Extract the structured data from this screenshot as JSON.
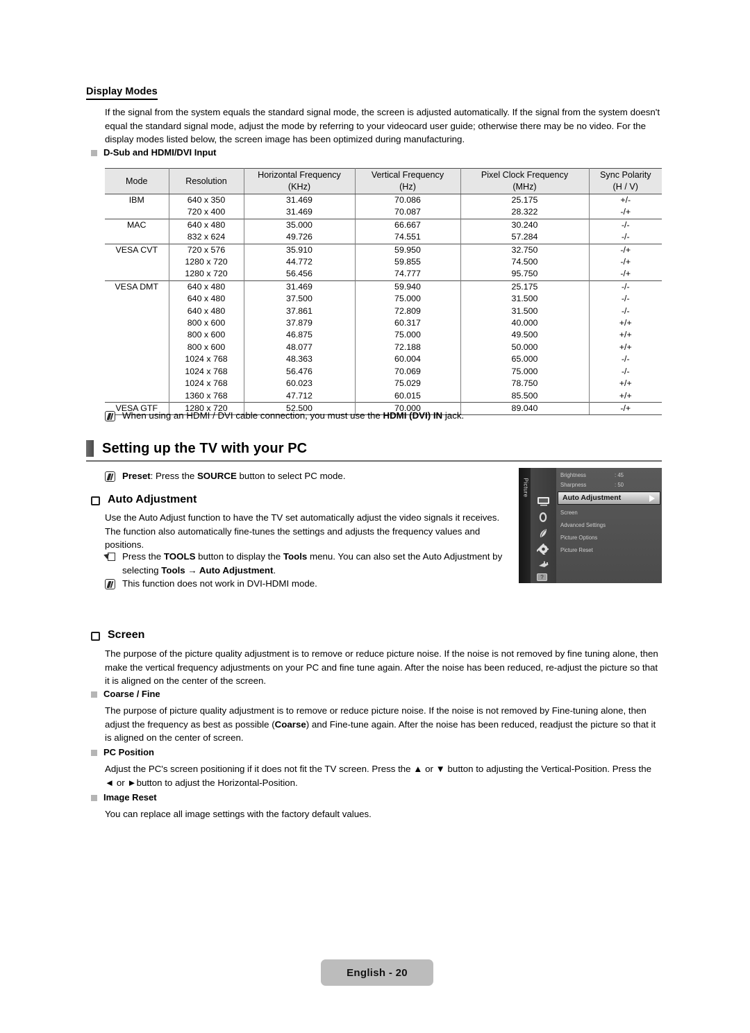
{
  "document": {
    "display_modes": {
      "section_title": "Display Modes",
      "intro": "If the signal from the system equals the standard signal mode, the screen is adjusted automatically. If the signal from the system doesn't equal the standard signal mode, adjust the mode by referring to your videocard user guide; otherwise there may be no video. For the display modes listed below, the screen image has been optimized during manufacturing.",
      "subheading": "D-Sub and HDMI/DVI Input"
    },
    "table": {
      "headers": [
        {
          "line1": "Mode",
          "line2": ""
        },
        {
          "line1": "Resolution",
          "line2": ""
        },
        {
          "line1": "Horizontal Frequency",
          "line2": "(KHz)"
        },
        {
          "line1": "Vertical Frequency",
          "line2": "(Hz)"
        },
        {
          "line1": "Pixel Clock Frequency",
          "line2": "(MHz)"
        },
        {
          "line1": "Sync Polarity",
          "line2": "(H / V)"
        }
      ],
      "rows": [
        {
          "mode": "IBM",
          "group_start": true,
          "resolution": "640 x 350",
          "hfreq": "31.469",
          "vfreq": "70.086",
          "pclock": "25.175",
          "sync": "+/-"
        },
        {
          "mode": "",
          "group_start": false,
          "resolution": "720 x 400",
          "hfreq": "31.469",
          "vfreq": "70.087",
          "pclock": "28.322",
          "sync": "-/+"
        },
        {
          "mode": "MAC",
          "group_start": true,
          "resolution": "640 x 480",
          "hfreq": "35.000",
          "vfreq": "66.667",
          "pclock": "30.240",
          "sync": "-/-"
        },
        {
          "mode": "",
          "group_start": false,
          "resolution": "832 x 624",
          "hfreq": "49.726",
          "vfreq": "74.551",
          "pclock": "57.284",
          "sync": "-/-"
        },
        {
          "mode": "VESA CVT",
          "group_start": true,
          "resolution": "720 x 576",
          "hfreq": "35.910",
          "vfreq": "59.950",
          "pclock": "32.750",
          "sync": "-/+"
        },
        {
          "mode": "",
          "group_start": false,
          "resolution": "1280 x 720",
          "hfreq": "44.772",
          "vfreq": "59.855",
          "pclock": "74.500",
          "sync": "-/+"
        },
        {
          "mode": "",
          "group_start": false,
          "resolution": "1280 x 720",
          "hfreq": "56.456",
          "vfreq": "74.777",
          "pclock": "95.750",
          "sync": "-/+"
        },
        {
          "mode": "VESA DMT",
          "group_start": true,
          "resolution": "640 x 480",
          "hfreq": "31.469",
          "vfreq": "59.940",
          "pclock": "25.175",
          "sync": "-/-"
        },
        {
          "mode": "",
          "group_start": false,
          "resolution": "640 x 480",
          "hfreq": "37.500",
          "vfreq": "75.000",
          "pclock": "31.500",
          "sync": "-/-"
        },
        {
          "mode": "",
          "group_start": false,
          "resolution": "640 x 480",
          "hfreq": "37.861",
          "vfreq": "72.809",
          "pclock": "31.500",
          "sync": "-/-"
        },
        {
          "mode": "",
          "group_start": false,
          "resolution": "800 x 600",
          "hfreq": "37.879",
          "vfreq": "60.317",
          "pclock": "40.000",
          "sync": "+/+"
        },
        {
          "mode": "",
          "group_start": false,
          "resolution": "800 x 600",
          "hfreq": "46.875",
          "vfreq": "75.000",
          "pclock": "49.500",
          "sync": "+/+"
        },
        {
          "mode": "",
          "group_start": false,
          "resolution": "800 x 600",
          "hfreq": "48.077",
          "vfreq": "72.188",
          "pclock": "50.000",
          "sync": "+/+"
        },
        {
          "mode": "",
          "group_start": false,
          "resolution": "1024 x 768",
          "hfreq": "48.363",
          "vfreq": "60.004",
          "pclock": "65.000",
          "sync": "-/-"
        },
        {
          "mode": "",
          "group_start": false,
          "resolution": "1024 x 768",
          "hfreq": "56.476",
          "vfreq": "70.069",
          "pclock": "75.000",
          "sync": "-/-"
        },
        {
          "mode": "",
          "group_start": false,
          "resolution": "1024 x 768",
          "hfreq": "60.023",
          "vfreq": "75.029",
          "pclock": "78.750",
          "sync": "+/+"
        },
        {
          "mode": "",
          "group_start": false,
          "resolution": "1360 x 768",
          "hfreq": "47.712",
          "vfreq": "60.015",
          "pclock": "85.500",
          "sync": "+/+"
        },
        {
          "mode": "VESA GTF",
          "group_start": true,
          "resolution": "1280 x 720",
          "hfreq": "52.500",
          "vfreq": "70.000",
          "pclock": "89.040",
          "sync": "-/+"
        }
      ]
    },
    "hdmi_note": {
      "part1": "When using an HDMI / DVI cable connection, you must use the ",
      "bold": "HDMI (DVI) IN",
      "part2": " jack."
    },
    "setting_up": {
      "heading": "Setting up the TV with your PC",
      "preset_note": {
        "bold1": "Preset",
        "part1": ": Press the ",
        "bold2": "SOURCE",
        "part2": " button to select PC mode."
      }
    },
    "auto_adjustment": {
      "heading": "Auto Adjustment",
      "paragraph": "Use the Auto Adjust function to have the TV set automatically adjust the video signals it receives. The function also automatically fine-tunes the settings and adjusts the frequency values and positions.",
      "tools_note": {
        "part1": "Press the ",
        "bold1": "TOOLS",
        "part2": " button to display the ",
        "bold2": "Tools",
        "part3": " menu. You can also set the Auto Adjustment by selecting ",
        "bold3": "Tools",
        "arrow": " → ",
        "bold4": "Auto Adjustment",
        "part4": "."
      },
      "dvi_note": "This function does not work in DVI-HDMI mode."
    },
    "screen": {
      "heading": "Screen",
      "paragraph": "The purpose of the picture quality adjustment is to remove or reduce picture noise. If the noise is not removed by fine tuning alone, then make the vertical frequency adjustments on your PC and fine tune again. After the noise has been reduced, re-adjust the picture so that it is aligned on the center of the screen.",
      "coarse_fine": {
        "subheading": "Coarse / Fine",
        "part1": "The purpose of picture quality adjustment is to remove or reduce picture noise. If the noise is not removed by Fine-tuning alone, then adjust the frequency as best as possible (",
        "bold1": "Coarse",
        "part2": ") and Fine-tune again. After the noise has been reduced, readjust the picture so that it is aligned on the center of screen."
      },
      "pc_position": {
        "subheading": "PC Position",
        "part1": "Adjust the PC's screen positioning if it does not fit the TV screen. Press the ",
        "up_arrow": "▲",
        "part2": " or ",
        "down_arrow": "▼",
        "part3": " button to adjusting the Vertical-Position. Press the ",
        "left_arrow": "◄",
        "part4": " or ",
        "right_arrow": "►",
        "part5": "button to adjust the Horizontal-Position."
      },
      "image_reset": {
        "subheading": "Image Reset",
        "paragraph": "You can replace all image settings with the factory default values."
      }
    },
    "osd": {
      "tab_label": "Picture",
      "items": [
        {
          "label": "Brightness",
          "value": ": 45"
        },
        {
          "label": "Sharpness",
          "value": ": 50"
        }
      ],
      "highlighted": "Auto Adjustment",
      "menu": [
        {
          "label": "Screen"
        },
        {
          "label": "Advanced Settings"
        },
        {
          "label": "Picture Options"
        },
        {
          "label": "Picture Reset"
        }
      ],
      "icons": [
        "picture-icon",
        "sound-icon",
        "channel-icon",
        "setup-icon",
        "input-icon",
        "support-icon"
      ]
    },
    "footer": {
      "page_label": "English - 20"
    }
  }
}
